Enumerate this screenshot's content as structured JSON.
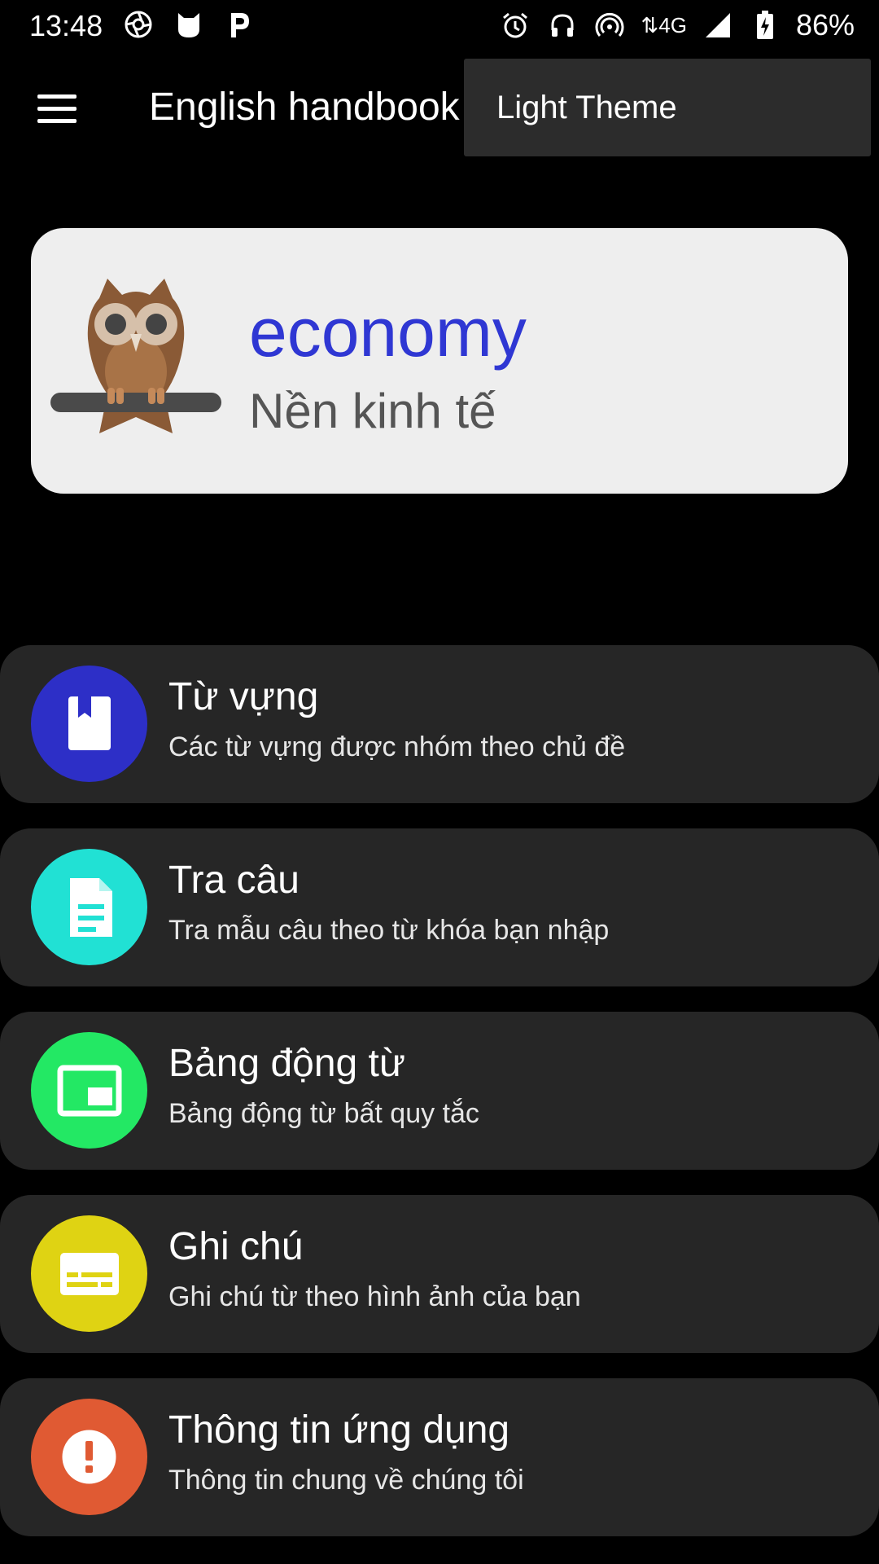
{
  "status_bar": {
    "time": "13:48",
    "left_icons": [
      "aperture-icon",
      "cat-icon",
      "p-icon"
    ],
    "right_icons": [
      "alarm-icon",
      "headphones-icon",
      "hotspot-icon"
    ],
    "network": "4G",
    "battery": "86%"
  },
  "app_bar": {
    "title": "English handbook",
    "menu_icon": "hamburger-menu-icon"
  },
  "popup_menu": {
    "items": [
      {
        "label": "Light Theme"
      }
    ]
  },
  "word_card": {
    "word": "economy",
    "meaning": "Nền kinh tế",
    "word_color": "#2f37d3",
    "mascot": "owl-icon"
  },
  "menu": {
    "items": [
      {
        "title": "Từ vựng",
        "subtitle": "Các từ vựng được nhóm theo chủ đề",
        "icon": "book-icon",
        "color": "#2d2fc7"
      },
      {
        "title": "Tra câu",
        "subtitle": "Tra mẫu câu theo từ khóa bạn nhập",
        "icon": "document-icon",
        "color": "#21e1d4"
      },
      {
        "title": "Bảng động từ",
        "subtitle": "Bảng động từ bất quy tắc",
        "icon": "picture-in-picture-icon",
        "color": "#23e864"
      },
      {
        "title": "Ghi chú",
        "subtitle": "Ghi chú từ theo hình ảnh của bạn",
        "icon": "subtitles-icon",
        "color": "#dfd313"
      },
      {
        "title": "Thông tin ứng dụng",
        "subtitle": "Thông tin chung về chúng tôi",
        "icon": "alert-icon",
        "color": "#e05a33"
      }
    ]
  }
}
